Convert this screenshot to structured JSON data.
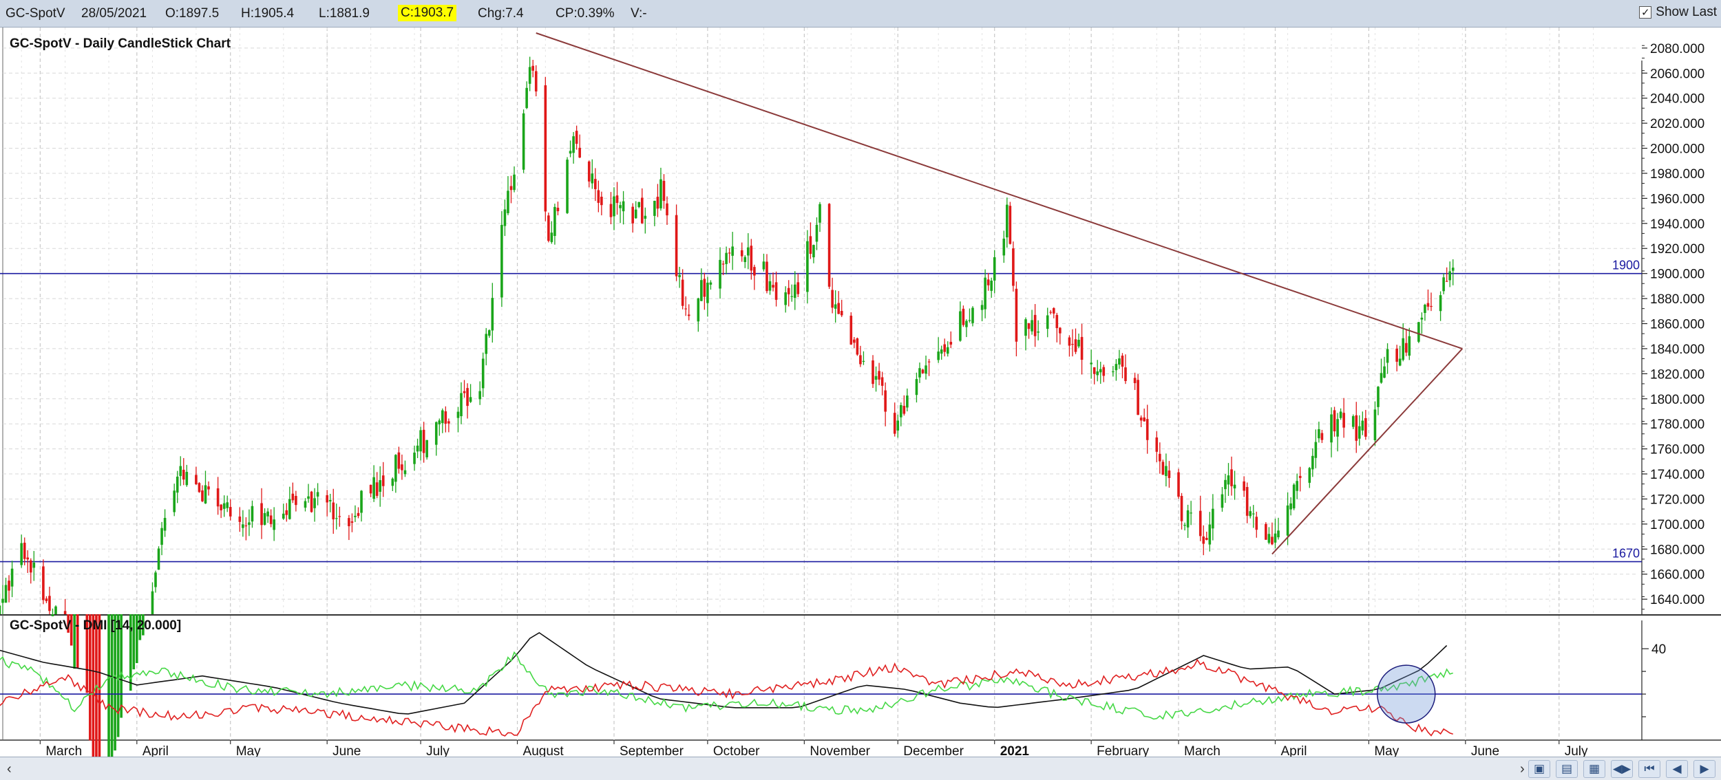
{
  "info_bar": {
    "symbol": "GC-SpotV",
    "date": "28/05/2021",
    "open": "O:1897.5",
    "high": "H:1905.4",
    "low": "L:1881.9",
    "close": "C:1903.7",
    "change": "Chg:7.4",
    "change_pct": "CP:0.39%",
    "volume": "V:-",
    "show_last_label": "Show Last",
    "show_last_checked": true
  },
  "nav_icons": [
    "scroll-left-icon",
    "scroll-right-icon",
    "zoom-in-icon",
    "zoom-out-icon",
    "save-icon",
    "fit-icon",
    "first-icon",
    "prev-icon",
    "next-icon"
  ],
  "colors": {
    "up": "#1aa51a",
    "down": "#e01818",
    "trendline": "#8b3a3a",
    "hline": "#1a1aa0",
    "adx": "#111111",
    "plus_di": "#46d846",
    "minus_di": "#e02020"
  },
  "chart_data": [
    {
      "type": "candlestick",
      "title": "GC-SpotV - Daily CandleStick Chart",
      "y_ticks": [
        "1640.000",
        "1660.000",
        "1680.000",
        "1700.000",
        "1720.000",
        "1740.000",
        "1760.000",
        "1780.000",
        "1800.000",
        "1820.000",
        "1840.000",
        "1860.000",
        "1880.000",
        "1900.000",
        "1920.000",
        "1940.000",
        "1960.000",
        "1980.000",
        "2000.000",
        "2020.000",
        "2040.000",
        "2060.000",
        "2080.000"
      ],
      "ylim": [
        1628,
        2092
      ],
      "x_labels": [
        "March",
        "April",
        "May",
        "June",
        "July",
        "August",
        "September",
        "October",
        "November",
        "December",
        "2021",
        "February",
        "March",
        "April",
        "May",
        "June",
        "July"
      ],
      "x_label_bold": "2021",
      "horizontal_lines": [
        {
          "label": "1900",
          "value": 1900
        },
        {
          "label": "1670",
          "value": 1670
        }
      ],
      "trendlines": [
        {
          "name": "resistance",
          "from": [
            "2020-08-07",
            2092
          ],
          "to": [
            "2021-05-31",
            1840
          ]
        },
        {
          "name": "support",
          "from": [
            "2021-03-31",
            1676
          ],
          "to": [
            "2021-05-31",
            1840
          ]
        }
      ],
      "close_path_date": [
        [
          "2020-02-10",
          1570
        ],
        [
          "2020-02-24",
          1680
        ],
        [
          "2020-03-09",
          1620
        ],
        [
          "2020-03-19",
          1480
        ],
        [
          "2020-03-31",
          1580
        ],
        [
          "2020-04-14",
          1745
        ],
        [
          "2020-04-27",
          1715
        ],
        [
          "2020-05-12",
          1700
        ],
        [
          "2020-05-27",
          1720
        ],
        [
          "2020-06-08",
          1705
        ],
        [
          "2020-06-22",
          1745
        ],
        [
          "2020-07-06",
          1775
        ],
        [
          "2020-07-20",
          1810
        ],
        [
          "2020-07-27",
          1935
        ],
        [
          "2020-08-06",
          2068
        ],
        [
          "2020-08-11",
          1920
        ],
        [
          "2020-08-18",
          2005
        ],
        [
          "2020-08-28",
          1960
        ],
        [
          "2020-09-08",
          1945
        ],
        [
          "2020-09-16",
          1965
        ],
        [
          "2020-09-24",
          1870
        ],
        [
          "2020-10-09",
          1925
        ],
        [
          "2020-10-28",
          1875
        ],
        [
          "2020-11-06",
          1950
        ],
        [
          "2020-11-10",
          1875
        ],
        [
          "2020-11-24",
          1810
        ],
        [
          "2020-11-30",
          1780
        ],
        [
          "2020-12-14",
          1840
        ],
        [
          "2020-12-28",
          1880
        ],
        [
          "2021-01-05",
          1945
        ],
        [
          "2021-01-08",
          1850
        ],
        [
          "2021-01-20",
          1860
        ],
        [
          "2021-02-05",
          1815
        ],
        [
          "2021-02-12",
          1825
        ],
        [
          "2021-02-26",
          1730
        ],
        [
          "2021-03-08",
          1685
        ],
        [
          "2021-03-18",
          1735
        ],
        [
          "2021-03-30",
          1684
        ],
        [
          "2021-04-09",
          1745
        ],
        [
          "2021-04-21",
          1785
        ],
        [
          "2021-04-30",
          1770
        ],
        [
          "2021-05-07",
          1832
        ],
        [
          "2021-05-14",
          1840
        ],
        [
          "2021-05-20",
          1875
        ],
        [
          "2021-05-28",
          1903.7
        ]
      ]
    },
    {
      "type": "line",
      "title": "GC-SpotV - DMI [14, 20.000]",
      "y_ticks": [
        "40"
      ],
      "ylim": [
        0,
        54
      ],
      "threshold": 20,
      "series": [
        {
          "key": "adx",
          "color": "#111111",
          "points_date": [
            [
              "2020-02-10",
              42
            ],
            [
              "2020-03-02",
              34
            ],
            [
              "2020-03-19",
              30
            ],
            [
              "2020-04-01",
              24
            ],
            [
              "2020-04-22",
              28
            ],
            [
              "2020-05-15",
              23
            ],
            [
              "2020-06-05",
              16
            ],
            [
              "2020-06-26",
              11
            ],
            [
              "2020-07-15",
              16
            ],
            [
              "2020-07-31",
              36
            ],
            [
              "2020-08-07",
              48
            ],
            [
              "2020-08-24",
              32
            ],
            [
              "2020-09-15",
              18
            ],
            [
              "2020-10-09",
              14
            ],
            [
              "2020-10-30",
              14
            ],
            [
              "2020-11-20",
              24
            ],
            [
              "2020-12-04",
              22
            ],
            [
              "2020-12-21",
              16
            ],
            [
              "2021-01-01",
              14
            ],
            [
              "2021-01-25",
              18
            ],
            [
              "2021-02-15",
              22
            ],
            [
              "2021-03-09",
              37
            ],
            [
              "2021-03-23",
              31
            ],
            [
              "2021-04-06",
              32
            ],
            [
              "2021-04-20",
              20
            ],
            [
              "2021-05-04",
              22
            ],
            [
              "2021-05-18",
              31
            ],
            [
              "2021-05-28",
              44
            ]
          ]
        },
        {
          "key": "plus_di",
          "color": "#46d846",
          "points_date": [
            [
              "2020-02-10",
              38
            ],
            [
              "2020-02-28",
              30
            ],
            [
              "2020-03-12",
              14
            ],
            [
              "2020-03-24",
              28
            ],
            [
              "2020-04-10",
              30
            ],
            [
              "2020-05-04",
              22
            ],
            [
              "2020-06-01",
              20
            ],
            [
              "2020-06-22",
              24
            ],
            [
              "2020-07-20",
              22
            ],
            [
              "2020-07-31",
              38
            ],
            [
              "2020-08-11",
              20
            ],
            [
              "2020-08-28",
              22
            ],
            [
              "2020-09-24",
              14
            ],
            [
              "2020-10-22",
              16
            ],
            [
              "2020-11-20",
              12
            ],
            [
              "2020-12-14",
              22
            ],
            [
              "2021-01-05",
              26
            ],
            [
              "2021-01-25",
              18
            ],
            [
              "2021-02-22",
              10
            ],
            [
              "2021-03-23",
              16
            ],
            [
              "2021-04-13",
              20
            ],
            [
              "2021-05-04",
              22
            ],
            [
              "2021-05-18",
              26
            ],
            [
              "2021-05-28",
              30
            ]
          ]
        },
        {
          "key": "minus_di",
          "color": "#e02020",
          "points_date": [
            [
              "2020-02-10",
              10
            ],
            [
              "2020-02-24",
              20
            ],
            [
              "2020-03-09",
              28
            ],
            [
              "2020-03-23",
              14
            ],
            [
              "2020-04-14",
              10
            ],
            [
              "2020-05-12",
              14
            ],
            [
              "2020-06-12",
              10
            ],
            [
              "2020-07-20",
              4
            ],
            [
              "2020-07-31",
              2
            ],
            [
              "2020-08-11",
              22
            ],
            [
              "2020-09-08",
              24
            ],
            [
              "2020-10-09",
              20
            ],
            [
              "2020-11-10",
              26
            ],
            [
              "2020-11-30",
              32
            ],
            [
              "2020-12-14",
              24
            ],
            [
              "2021-01-08",
              30
            ],
            [
              "2021-01-25",
              24
            ],
            [
              "2021-02-26",
              30
            ],
            [
              "2021-03-08",
              34
            ],
            [
              "2021-03-30",
              22
            ],
            [
              "2021-04-20",
              12
            ],
            [
              "2021-05-04",
              14
            ],
            [
              "2021-05-18",
              4
            ],
            [
              "2021-05-28",
              2
            ]
          ]
        }
      ]
    }
  ]
}
